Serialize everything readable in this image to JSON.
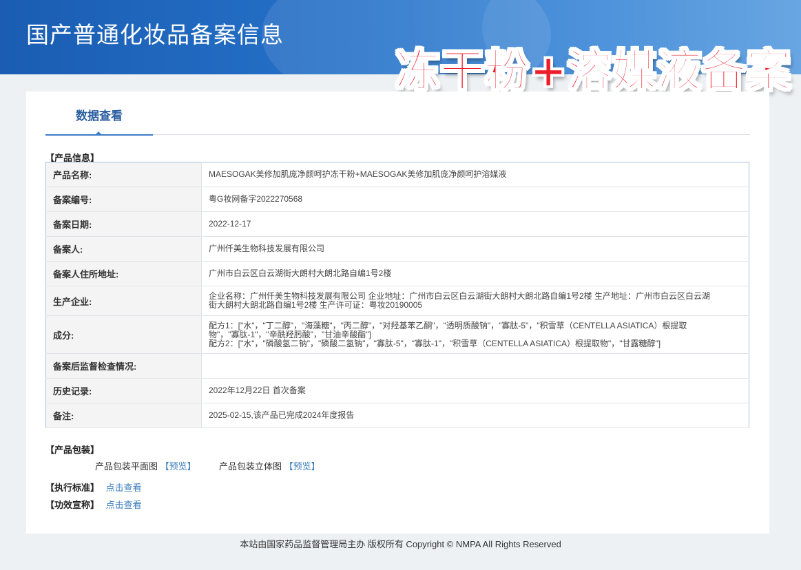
{
  "header": {
    "title": "国产普通化妆品备案信息",
    "overlay_title": "冻干粉+溶媒液备案"
  },
  "tabs": [
    {
      "label": "数据查看",
      "active": true
    }
  ],
  "product_info": {
    "section_label": "【产品信息】",
    "rows": [
      {
        "label": "产品名称:",
        "value": "MAESOGAK美修加肌庞净颜呵护冻干粉+MAESOGAK美修加肌庞净颜呵护溶媒液"
      },
      {
        "label": "备案编号:",
        "value": "粤G妆网备字2022270568"
      },
      {
        "label": "备案日期:",
        "value": "2022-12-17"
      },
      {
        "label": "备案人:",
        "value": "广州仟美生物科技发展有限公司"
      },
      {
        "label": "备案人住所地址:",
        "value": "广州市白云区白云湖街大朗村大朗北路自编1号2楼"
      },
      {
        "label": "生产企业:",
        "value": "企业名称：广州仟美生物科技发展有限公司 企业地址：广州市白云区白云湖街大朗村大朗北路自编1号2楼 生产地址：广州市白云区白云湖街大朗村大朗北路自编1号2楼 生产许可证：粤妆20190005"
      },
      {
        "label": "成分:",
        "value": "配方1：[\"水\"，\"丁二醇\"，\"海藻糖\"，\"丙二醇\"，\"对羟基苯乙酮\"，\"透明质酸钠\"，\"寡肽-5\"，\"积雪草（CENTELLA ASIATICA）根提取物\"，\"寡肽-1\"，\"辛酰羟肟酸\"，\"甘油辛酸酯\"]\n配方2：[\"水\"，\"磷酸氢二钠\"，\"磷酸二氢钠\"，\"寡肽-5\"，\"寡肽-1\"，\"积雪草（CENTELLA ASIATICA）根提取物\"，\"甘露糖醇\"]"
      },
      {
        "label": "备案后监督检查情况:",
        "value": ""
      },
      {
        "label": "历史记录:",
        "value": "2022年12月22日 首次备案"
      },
      {
        "label": "备注:",
        "value": "2025-02-15,该产品已完成2024年度报告"
      }
    ]
  },
  "packaging": {
    "section_label": "【产品包装】",
    "flat_label": "产品包装平面图",
    "flat_link": "【预览】",
    "solid_label": "产品包装立体图",
    "solid_link": "【预览】"
  },
  "standard": {
    "label": "【执行标准】",
    "link": "点击查看"
  },
  "efficacy": {
    "label": "【功效宣称】",
    "link": "点击查看"
  },
  "footer": {
    "text": "本站由国家药品监督管理局主办 版权所有 Copyright © NMPA All Rights Reserved"
  }
}
